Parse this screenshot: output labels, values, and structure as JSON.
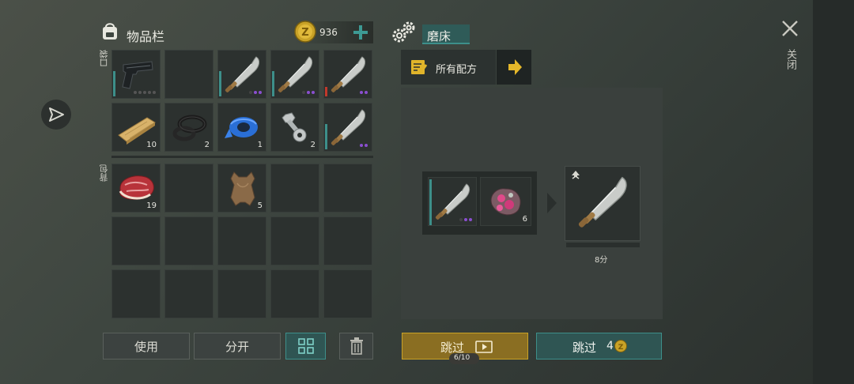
{
  "inventory": {
    "title": "物品栏",
    "coins": "936",
    "pocket_label": "口袋",
    "backpack_label": "背包",
    "pocket_slots": [
      {
        "icon": "pistol",
        "count": "",
        "bar": "#3d8f8a",
        "dots": [
          "#555",
          "#555",
          "#555",
          "#555",
          "#555"
        ]
      },
      {
        "icon": "",
        "count": ""
      },
      {
        "icon": "machete",
        "count": "",
        "bar": "#3d8f8a",
        "dots": [
          "#444",
          "#8a4fd0",
          "#8a4fd0"
        ]
      },
      {
        "icon": "machete",
        "count": "",
        "bar": "#3d8f8a",
        "dots": [
          "#444",
          "#8a4fd0",
          "#8a4fd0"
        ]
      },
      {
        "icon": "machete",
        "count": "",
        "bar": "#c0392b",
        "dots": [
          "#8a4fd0",
          "#8a4fd0"
        ]
      },
      {
        "icon": "wood-plank",
        "count": "10"
      },
      {
        "icon": "rubber-rings",
        "count": "2"
      },
      {
        "icon": "blue-tape",
        "count": "1"
      },
      {
        "icon": "bolt-and-nut",
        "count": "2"
      },
      {
        "icon": "machete",
        "count": "",
        "bar": "#3d8f8a",
        "dots": [
          "#8a4fd0",
          "#8a4fd0"
        ]
      }
    ],
    "backpack_slots": [
      {
        "icon": "raw-meat",
        "count": "19"
      },
      {
        "icon": "",
        "count": ""
      },
      {
        "icon": "leather-hide",
        "count": "5"
      },
      {
        "icon": "",
        "count": ""
      },
      {
        "icon": "",
        "count": ""
      },
      {
        "icon": "",
        "count": ""
      },
      {
        "icon": "",
        "count": ""
      },
      {
        "icon": "",
        "count": ""
      },
      {
        "icon": "",
        "count": ""
      },
      {
        "icon": "",
        "count": ""
      },
      {
        "icon": "",
        "count": ""
      },
      {
        "icon": "",
        "count": ""
      },
      {
        "icon": "",
        "count": ""
      },
      {
        "icon": "",
        "count": ""
      },
      {
        "icon": "",
        "count": ""
      }
    ],
    "use_label": "使用",
    "split_label": "分开"
  },
  "crafting": {
    "station_name": "磨床",
    "recipes_label": "所有配方",
    "ingredient_count": "6",
    "time_label": "8分",
    "skip_video_label": "跳过",
    "video_progress": "6/10",
    "skip_coin_label": "跳过",
    "skip_coin_cost": "4"
  },
  "close_label": "关闭",
  "colors": {
    "accent_teal": "#3d8f8a",
    "gold": "#c9a227",
    "rare_purple": "#8a4fd0"
  }
}
